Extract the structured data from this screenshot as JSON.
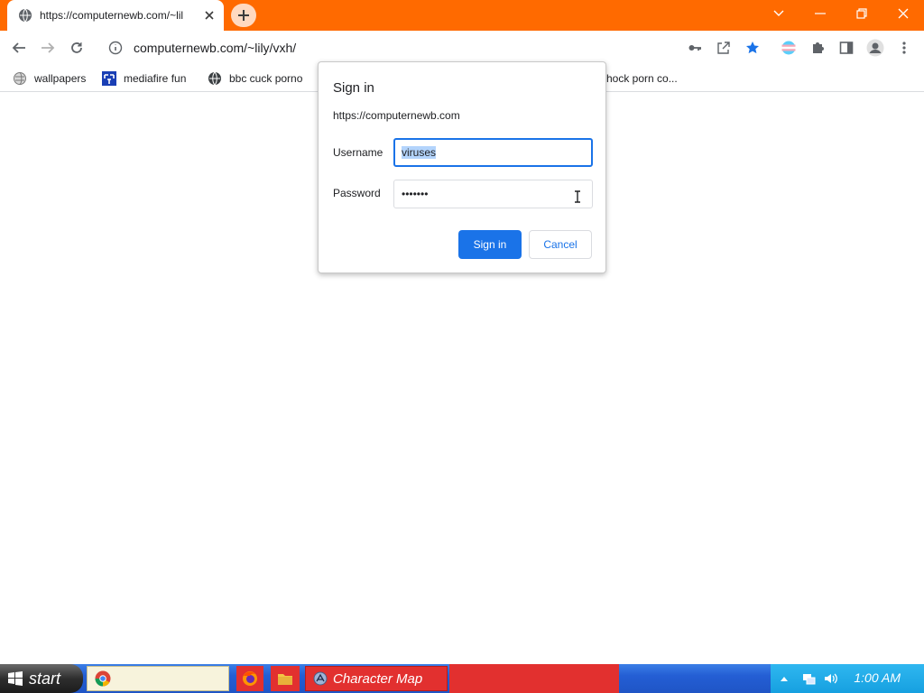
{
  "browser": {
    "tab": {
      "title": "https://computernewb.com/~lil"
    },
    "address_bar": {
      "url": "computernewb.com/~lily/vxh/"
    },
    "bookmarks": [
      {
        "label": "wallpapers",
        "icon": "wallpaper-globe-icon"
      },
      {
        "label": "mediafire fun",
        "icon": "mediafire-icon"
      },
      {
        "label": "bbc cuck porno",
        "icon": "globe-icon"
      },
      {
        "label": "hock porn co...",
        "icon": "globe-icon"
      }
    ]
  },
  "dialog": {
    "title": "Sign in",
    "origin": "https://computernewb.com",
    "username_label": "Username",
    "username_value": "viruses",
    "password_label": "Password",
    "password_value": "•••••••",
    "signin_label": "Sign in",
    "cancel_label": "Cancel"
  },
  "taskbar": {
    "start_label": "start",
    "items": [
      {
        "label": "",
        "icon": "chrome-icon"
      },
      {
        "label": "",
        "icon": "firefox-icon"
      },
      {
        "label": "",
        "icon": "folder-icon"
      },
      {
        "label": "Character Map",
        "icon": "character-map-icon"
      }
    ],
    "clock": "1:00 AM"
  },
  "colors": {
    "titlebar": "#ff6a00",
    "accent": "#1a73e8",
    "taskbar": "#245ed4",
    "tray": "#16a0e0"
  }
}
